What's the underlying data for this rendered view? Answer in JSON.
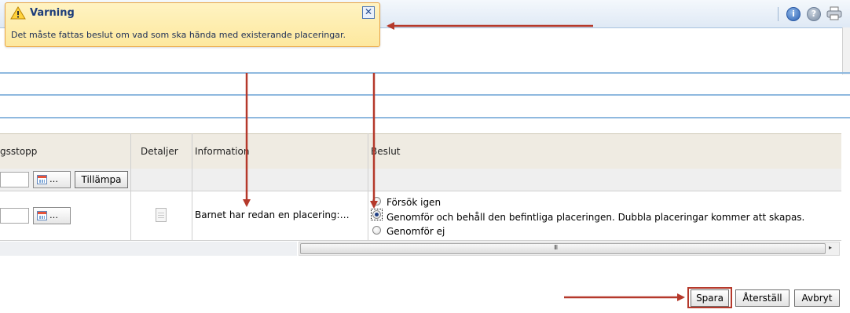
{
  "warning": {
    "title": "Varning",
    "message": "Det måste fattas beslut om vad som ska hända med existerande placeringar.",
    "close_glyph": "✕"
  },
  "toolbar": {
    "icons": [
      "info-icon",
      "help-icon",
      "print-icon"
    ],
    "info_glyph": "i",
    "help_glyph": "?"
  },
  "table": {
    "columns": [
      "gsstopp",
      "Detaljer",
      "Information",
      "Beslut"
    ],
    "filter_row": {
      "calendar_dots": "…",
      "apply_label": "Tillämpa"
    },
    "row": {
      "calendar_dots": "…",
      "information": "Barnet har redan en placering:…",
      "beslut_options": [
        {
          "label": "Försök igen",
          "selected": false
        },
        {
          "label": "Genomför och behåll den befintliga placeringen. Dubbla placeringar kommer att skapas.",
          "selected": true
        },
        {
          "label": "Genomför ej",
          "selected": false
        }
      ]
    },
    "scrollbar": {
      "grip": "III",
      "right_arrow": "▸"
    }
  },
  "buttons": {
    "save": "Spara",
    "reset": "Återställ",
    "cancel": "Avbryt"
  },
  "colors": {
    "annotation_arrow": "#b5392b",
    "warning_bg": "#fde89e",
    "warning_border": "#e9a547",
    "header_line": "#8fb9df"
  }
}
